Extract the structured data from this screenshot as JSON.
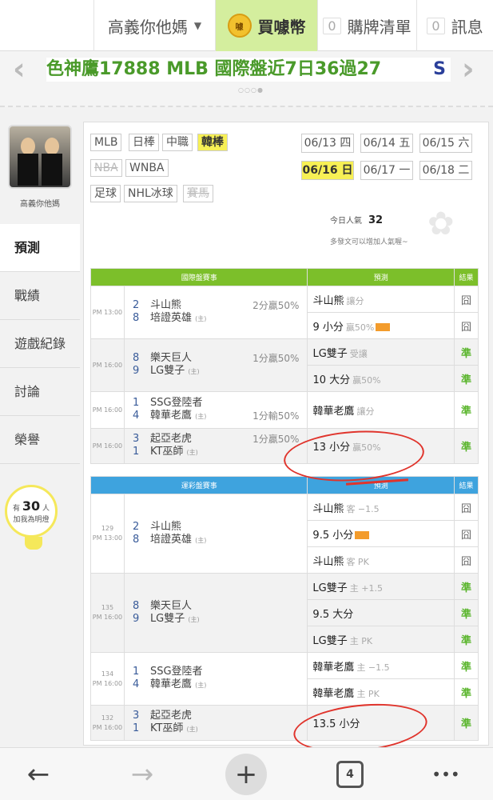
{
  "topnav": {
    "user_label": "高義你他媽",
    "buy_label": "買噱幣",
    "coin_text": "噱",
    "cart_count": "0",
    "cart_label": "購牌清單",
    "msg_count": "0",
    "msg_label": "訊息"
  },
  "banner": {
    "marquee_text": "色神鷹17888 MLB 國際盤近7日36過27",
    "marquee_tail": "S",
    "left_arrow": "‹",
    "right_arrow": "›",
    "dots": "○○○●"
  },
  "sidebar": {
    "username": "高義你他媽",
    "items": [
      {
        "label": "預測"
      },
      {
        "label": "戰績"
      },
      {
        "label": "遊戲紀錄"
      },
      {
        "label": "討論"
      },
      {
        "label": "榮譽"
      }
    ],
    "bulb_prefix": "有",
    "bulb_count": "30",
    "bulb_suffix": "人",
    "bulb_text": "加我為明燈"
  },
  "categories": {
    "row1": [
      "MLB",
      "日棒",
      "中職",
      "韓棒"
    ],
    "row2": [
      "NBA",
      "WNBA"
    ],
    "row3": [
      "足球",
      "NHL冰球",
      "賽馬"
    ]
  },
  "dates": [
    {
      "label": "06/13 四"
    },
    {
      "label": "06/14 五"
    },
    {
      "label": "06/15 六"
    },
    {
      "label": "06/16 日"
    },
    {
      "label": "06/17 一"
    },
    {
      "label": "06/18 二"
    }
  ],
  "popularity": {
    "label": "今日人氣",
    "value": "32",
    "hint": "多發文可以增加人氣喔~"
  },
  "intl": {
    "header": {
      "event": "國際盤賽事",
      "pred": "預測",
      "result": "結果"
    },
    "games": [
      {
        "time": "PM 13:00",
        "away_no": "2",
        "away": "斗山熊",
        "tip": "2分贏50%",
        "home_no": "8",
        "home": "培證英雄",
        "home_mark": "(主)",
        "preds": [
          {
            "main": "斗山熊",
            "sub": "讓分",
            "result": "囧"
          },
          {
            "main": "9 小分",
            "sub": "贏50%",
            "result": "囧"
          }
        ]
      },
      {
        "time": "PM 16:00",
        "away_no": "8",
        "away": "樂天巨人",
        "tip": "1分贏50%",
        "home_no": "9",
        "home": "LG雙子",
        "home_mark": "(主)",
        "preds": [
          {
            "main": "LG雙子",
            "sub": "受讓",
            "result": "準"
          },
          {
            "main": "10 大分",
            "sub": "贏50%",
            "result": "準"
          }
        ]
      },
      {
        "time": "PM 16:00",
        "away_no": "1",
        "away": "SSG登陸者",
        "tip": "1分輸50%",
        "home_no": "4",
        "home": "韓華老鷹",
        "home_mark": "(主)",
        "preds": [
          {
            "main": "韓華老鷹",
            "sub": "讓分",
            "result": "準"
          }
        ]
      },
      {
        "time": "PM 16:00",
        "away_no": "3",
        "away": "起亞老虎",
        "tip": "1分贏50%",
        "home_no": "1",
        "home": "KT巫師",
        "home_mark": "(主)",
        "preds": [
          {
            "main": "13 小分",
            "sub": "贏50%",
            "result": "準"
          }
        ]
      }
    ]
  },
  "lottery": {
    "header": {
      "event": "運彩盤賽事",
      "pred": "預測",
      "result": "結果"
    },
    "games": [
      {
        "id": "129",
        "time": "PM 13:00",
        "away_no": "2",
        "away": "斗山熊",
        "home_no": "8",
        "home": "培證英雄",
        "home_mark": "(主)",
        "preds": [
          {
            "main": "斗山熊",
            "sub": "客 −1.5",
            "result": "囧"
          },
          {
            "main": "9.5 小分",
            "sub": "",
            "result": "囧"
          },
          {
            "main": "斗山熊",
            "sub": "客 PK",
            "result": "囧"
          }
        ]
      },
      {
        "id": "135",
        "time": "PM 16:00",
        "away_no": "8",
        "away": "樂天巨人",
        "home_no": "9",
        "home": "LG雙子",
        "home_mark": "(主)",
        "preds": [
          {
            "main": "LG雙子",
            "sub": "主 +1.5",
            "result": "準"
          },
          {
            "main": "9.5 大分",
            "sub": "",
            "result": "準"
          },
          {
            "main": "LG雙子",
            "sub": "主 PK",
            "result": "準"
          }
        ]
      },
      {
        "id": "134",
        "time": "PM 16:00",
        "away_no": "1",
        "away": "SSG登陸者",
        "home_no": "4",
        "home": "韓華老鷹",
        "home_mark": "(主)",
        "preds": [
          {
            "main": "韓華老鷹",
            "sub": "主 −1.5",
            "result": "準"
          },
          {
            "main": "韓華老鷹",
            "sub": "主 PK",
            "result": "準"
          }
        ]
      },
      {
        "id": "132",
        "time": "PM 16:00",
        "away_no": "3",
        "away": "起亞老虎",
        "home_no": "1",
        "home": "KT巫師",
        "home_mark": "(主)",
        "preds": [
          {
            "main": "13.5 小分",
            "sub": "",
            "result": "準"
          }
        ]
      }
    ]
  },
  "bottombar": {
    "back": "←",
    "forward": "→",
    "new_tab": "+",
    "tab_count": "4",
    "more": "•••"
  },
  "colors": {
    "intl_header": "#7cbf2a",
    "lottery_header": "#3ea3de",
    "win": "#5ab52c",
    "highlight": "#f7f055",
    "annotation": "#e0342c"
  }
}
